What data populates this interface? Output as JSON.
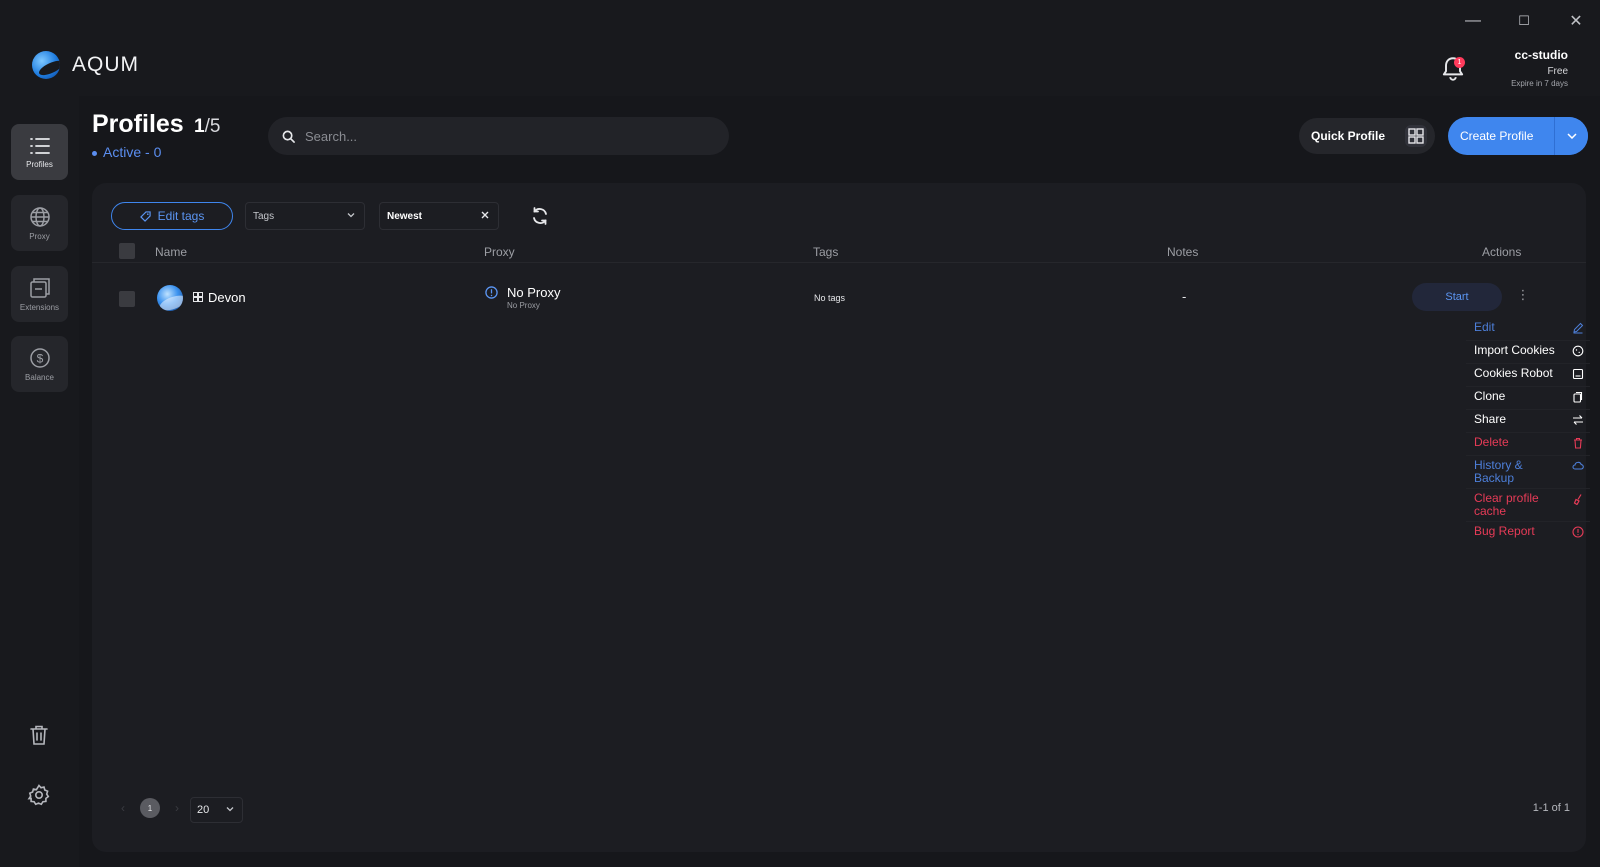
{
  "app": {
    "name": "AQUM"
  },
  "window": {
    "minimize": "—",
    "maximize": "☐",
    "close": "✕"
  },
  "notifications": {
    "count": "1",
    "icon": "bell-icon"
  },
  "account": {
    "name": "cc-studio",
    "plan": "Free",
    "expire": "Expire in 7 days"
  },
  "sidebar": {
    "items": [
      {
        "label": "Profiles",
        "icon": "list-icon",
        "active": true
      },
      {
        "label": "Proxy",
        "icon": "globe-icon",
        "active": false
      },
      {
        "label": "Extensions",
        "icon": "extensions-icon",
        "active": false
      },
      {
        "label": "Balance",
        "icon": "dollar-icon",
        "active": false
      }
    ],
    "bottom": [
      {
        "icon": "trash-icon"
      },
      {
        "icon": "gear-icon"
      }
    ]
  },
  "header": {
    "title": "Profiles",
    "count_current": "1",
    "count_total": "/5",
    "active_status": "Active - 0"
  },
  "search": {
    "placeholder": "Search..."
  },
  "buttons": {
    "quick_profile": "Quick Profile",
    "create_profile": "Create Profile"
  },
  "toolbar": {
    "edit_tags": "Edit tags",
    "tags_select": "Tags",
    "sort_select": "Newest"
  },
  "table": {
    "columns": [
      "Name",
      "Proxy",
      "Tags",
      "Notes",
      "Actions"
    ],
    "rows": [
      {
        "name": "Devon",
        "proxy": "No Proxy",
        "proxy_sub": "No Proxy",
        "tags": "No tags",
        "notes": "-",
        "action": "Start"
      }
    ]
  },
  "actions_menu": [
    {
      "label": "Edit",
      "color": "#4d7fd9",
      "icon": "pencil-icon"
    },
    {
      "label": "Import Cookies",
      "color": "#ffffff",
      "icon": "cookie-icon"
    },
    {
      "label": "Cookies Robot",
      "color": "#ffffff",
      "icon": "robot-icon"
    },
    {
      "label": "Clone",
      "color": "#ffffff",
      "icon": "copy-icon"
    },
    {
      "label": "Share",
      "color": "#ffffff",
      "icon": "share-arrows-icon"
    },
    {
      "label": "Delete",
      "color": "#e63b57",
      "icon": "trash-icon"
    },
    {
      "label": "History & Backup",
      "color": "#4d7fd9",
      "icon": "cloud-icon"
    },
    {
      "label": "Clear profile cache",
      "color": "#e63b57",
      "icon": "broom-icon"
    },
    {
      "label": "Bug Report",
      "color": "#e63b57",
      "icon": "alert-circle-icon"
    }
  ],
  "pagination": {
    "current_page": "1",
    "page_size": "20",
    "range": "1-1 of 1"
  },
  "colors": {
    "accent": "#3f86ee",
    "danger": "#e63b57",
    "background": "#16171b"
  }
}
